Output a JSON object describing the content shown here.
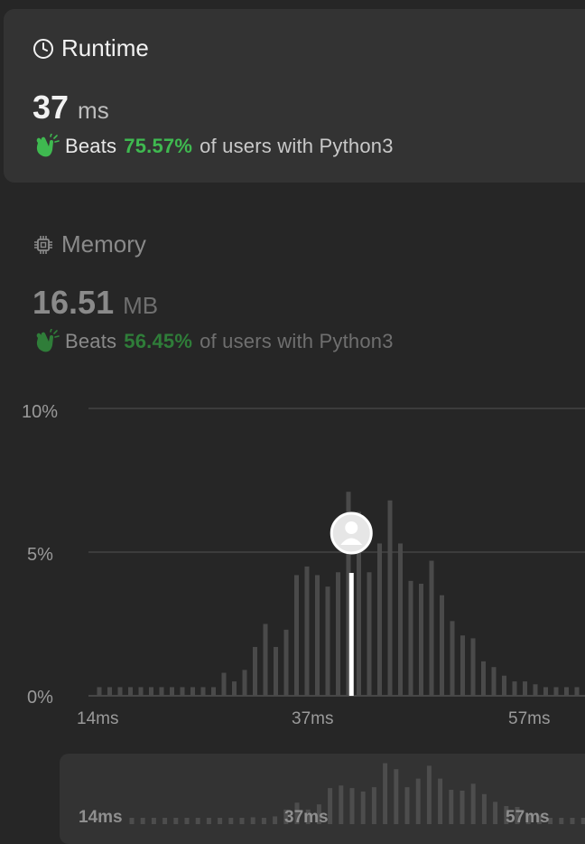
{
  "runtime": {
    "title": "Runtime",
    "value": "37",
    "unit": "ms",
    "beats_label": "Beats",
    "beats_pct": "75.57%",
    "beats_suffix": "of users with Python3"
  },
  "memory": {
    "title": "Memory",
    "value": "16.51",
    "unit": "MB",
    "beats_label": "Beats",
    "beats_pct": "56.45%",
    "beats_suffix": "of users with Python3"
  },
  "colors": {
    "accent_green": "#3fb950",
    "accent_green_dim": "#2f7d39",
    "bar": "#4a4a4a",
    "highlight": "#ffffff"
  },
  "icons": {
    "runtime": "clock-icon",
    "memory": "chip-icon",
    "beats": "clapping-hands-icon",
    "marker": "user-avatar-icon"
  },
  "chart_data": {
    "type": "bar",
    "unit_x": "ms",
    "y_ticks": [
      "10%",
      "5%",
      "0%"
    ],
    "ylim": [
      0,
      10
    ],
    "x_ticks": [
      {
        "label": "14ms",
        "value": 14
      },
      {
        "label": "37ms",
        "value": 37
      },
      {
        "label": "57ms",
        "value": 57
      }
    ],
    "x": [
      13,
      14,
      15,
      16,
      17,
      18,
      19,
      20,
      21,
      22,
      23,
      24,
      25,
      26,
      27,
      28,
      29,
      30,
      31,
      32,
      33,
      34,
      35,
      36,
      37,
      38,
      39,
      40,
      41,
      42,
      43,
      44,
      45,
      46,
      47,
      48,
      49,
      50,
      51,
      52,
      53,
      54,
      55,
      56,
      57,
      58,
      59,
      60,
      61,
      62,
      63,
      64
    ],
    "values": [
      0.3,
      0.3,
      0.3,
      0.3,
      0.3,
      0.3,
      0.3,
      0.3,
      0.3,
      0.3,
      0.3,
      0.3,
      0.8,
      0.5,
      0.9,
      1.7,
      2.5,
      1.7,
      2.3,
      4.2,
      4.5,
      4.2,
      3.8,
      4.3,
      7.1,
      6.4,
      4.3,
      5.3,
      6.8,
      5.3,
      4.0,
      3.9,
      4.7,
      3.5,
      2.6,
      2.1,
      2.0,
      1.2,
      1.0,
      0.7,
      0.5,
      0.5,
      0.4,
      0.3,
      0.3,
      0.3,
      0.3,
      0.3,
      0.3,
      0.3,
      0.3,
      0.3
    ],
    "highlight_x": 37,
    "grid": true
  },
  "overview": {
    "x_ticks": [
      "14ms",
      "37ms",
      "57ms"
    ]
  }
}
